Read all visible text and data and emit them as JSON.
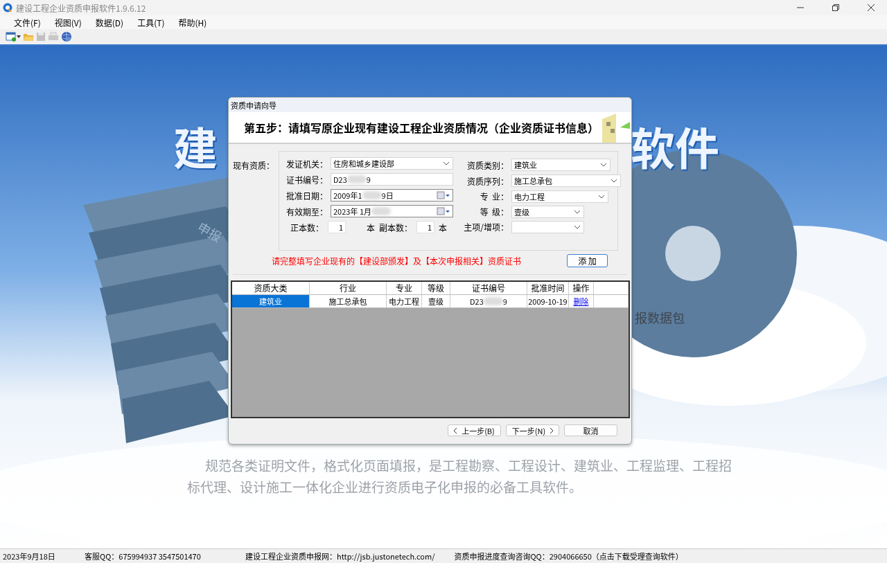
{
  "window": {
    "title": "建设工程企业资质申报软件1.9.6.12"
  },
  "menu": [
    {
      "label": "文件(F)"
    },
    {
      "label": "视图(V)"
    },
    {
      "label": "数据(D)"
    },
    {
      "label": "工具(T)"
    },
    {
      "label": "帮助(H)"
    }
  ],
  "toolbar": [
    {
      "kind": "new",
      "disabled": false
    },
    {
      "kind": "open",
      "disabled": false
    },
    {
      "kind": "save",
      "disabled": true
    },
    {
      "kind": "print",
      "disabled": true
    },
    {
      "kind": "globe",
      "disabled": false
    }
  ],
  "background": {
    "banner_left": "建",
    "banner_right": "软件",
    "folder_label": "申报",
    "side_label": "报数据包",
    "paragraph": [
      "规范各类证明文件，格式化页面填报，是工程勘察、工程设计、建筑业、工程监理、工程招",
      "标代理、设计施工一体化企业进行资质电子化申报的必备工具软件。"
    ]
  },
  "dialog": {
    "title": "资质申请向导",
    "heading": "第五步：请填写原企业现有建设工程企业资质情况（企业资质证书信息）",
    "group_label": "现有资质：",
    "left_fields": [
      {
        "kind": "select",
        "label": "发证机关：",
        "value": "住房和城乡建设部"
      },
      {
        "kind": "text",
        "label": "证书编号：",
        "value": "D23",
        "value_end": "9"
      },
      {
        "kind": "date",
        "label": "批准日期：",
        "value": "2009年1",
        "value_end": "9日"
      },
      {
        "kind": "date",
        "label": "有效期至：",
        "value": "2023年 1月"
      }
    ],
    "copies": {
      "label": "正本数：",
      "value": "1",
      "unit": "本",
      "copy_label": "副本数：",
      "copy_value": "1",
      "copy_unit": "本"
    },
    "right_fields": [
      {
        "label": "资质类别：",
        "value": "建筑业"
      },
      {
        "label": "资质序列：",
        "value": "施工总承包"
      },
      {
        "label": "专  业：",
        "value": "电力工程"
      },
      {
        "label": "等  级：",
        "value": "壹级"
      },
      {
        "label": "主项/增项："
      }
    ],
    "note": "请完整填写企业现有的【建设部颁发】及【本次申报相关】资质证书",
    "add_button": "添 加",
    "table": {
      "columns": [
        "资质大类",
        "行业",
        "专业",
        "等级",
        "证书编号",
        "批准时间",
        "操作"
      ],
      "rows": [
        {
          "selected": true,
          "cells": [
            "建筑业",
            "施工总承包",
            "电力工程",
            "壹级",
            "D23",
            "2009-10-19",
            "删除"
          ],
          "cert_end": "9"
        }
      ]
    },
    "buttons": [
      {
        "label": "上一步(B)",
        "kind": "prev"
      },
      {
        "label": "下一步(N)",
        "kind": "next"
      },
      {
        "label": "取消",
        "kind": "plain"
      }
    ]
  },
  "status_bar": [
    "2023年9月18日",
    "客服QQ：675994937   3547501470",
    "建设工程企业资质申报网：http://jsb.justonetech.com/",
    "资质申报进度查询咨询QQ：2904066650（点击下载受理查询软件）"
  ]
}
